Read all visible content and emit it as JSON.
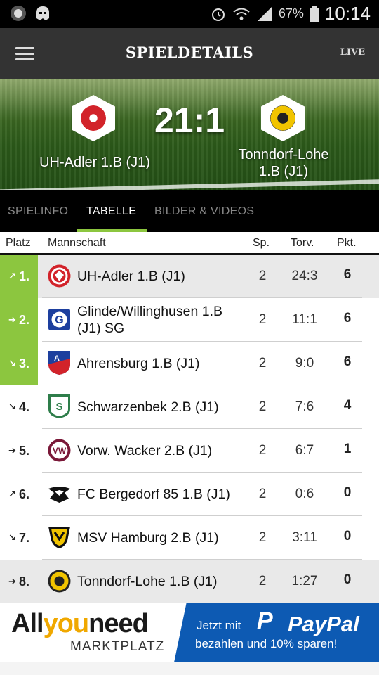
{
  "status_bar": {
    "battery": "67%",
    "time": "10:14"
  },
  "app_bar": {
    "title": "SPIELDETAILS",
    "live_label": "LIVE"
  },
  "match": {
    "score": "21:1",
    "home_team": "UH-Adler 1.B (J1)",
    "away_team_line1": "Tonndorf-Lohe",
    "away_team_line2": "1.B (J1)"
  },
  "tabs": [
    "SPIELINFO",
    "TABELLE",
    "BILDER & VIDEOS"
  ],
  "active_tab": "TABELLE",
  "table": {
    "headers": {
      "platz": "Platz",
      "mannschaft": "Mannschaft",
      "sp": "Sp.",
      "torv": "Torv.",
      "pkt": "Pkt."
    },
    "rows": [
      {
        "rank": "1.",
        "trend": "↗",
        "team": "UH-Adler 1.B (J1)",
        "sp": "2",
        "torv": "24:3",
        "pkt": "6",
        "logo": "uh-adler-logo",
        "promotion": true,
        "highlight": true
      },
      {
        "rank": "2.",
        "trend": "➔",
        "team": "Glinde/Willinghusen 1.B (J1) SG",
        "sp": "2",
        "torv": "11:1",
        "pkt": "6",
        "logo": "glinde-logo",
        "promotion": true,
        "highlight": false
      },
      {
        "rank": "3.",
        "trend": "↘",
        "team": "Ahrensburg 1.B (J1)",
        "sp": "2",
        "torv": "9:0",
        "pkt": "6",
        "logo": "ahrensburg-logo",
        "promotion": true,
        "highlight": false
      },
      {
        "rank": "4.",
        "trend": "↘",
        "team": "Schwarzenbek 2.B (J1)",
        "sp": "2",
        "torv": "7:6",
        "pkt": "4",
        "logo": "schwarzenbek-logo",
        "promotion": false,
        "highlight": false
      },
      {
        "rank": "5.",
        "trend": "➔",
        "team": "Vorw. Wacker 2.B (J1)",
        "sp": "2",
        "torv": "6:7",
        "pkt": "1",
        "logo": "vorw-wacker-logo",
        "promotion": false,
        "highlight": false
      },
      {
        "rank": "6.",
        "trend": "↗",
        "team": "FC Bergedorf 85 1.B (J1)",
        "sp": "2",
        "torv": "0:6",
        "pkt": "0",
        "logo": "fc-bergedorf-logo",
        "promotion": false,
        "highlight": false
      },
      {
        "rank": "7.",
        "trend": "↘",
        "team": "MSV Hamburg 2.B (J1)",
        "sp": "2",
        "torv": "3:11",
        "pkt": "0",
        "logo": "msv-hamburg-logo",
        "promotion": false,
        "highlight": false
      },
      {
        "rank": "8.",
        "trend": "➔",
        "team": "Tonndorf-Lohe 1.B (J1)",
        "sp": "2",
        "torv": "1:27",
        "pkt": "0",
        "logo": "tonndorf-lohe-logo",
        "promotion": false,
        "highlight": true
      }
    ]
  },
  "ad": {
    "brand_all": "All",
    "brand_you": "you",
    "brand_need": "need",
    "brand_sub": "MARKTPLATZ",
    "jetzt": "Jetzt mit",
    "paypal_p": "P",
    "paypal_word": "PayPal",
    "line2": "bezahlen und 10% sparen!"
  },
  "colors": {
    "accent_green": "#8cc63f",
    "app_bar": "#333333",
    "paypal_blue": "#0d5ab3"
  }
}
